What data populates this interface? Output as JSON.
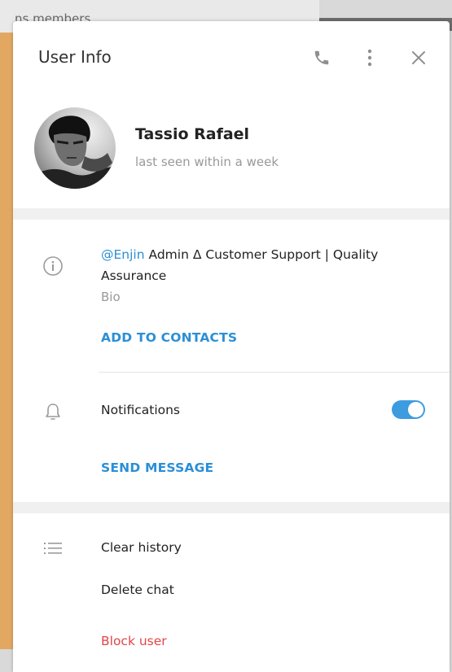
{
  "backdrop": {
    "partial_text": "ns members"
  },
  "header": {
    "title": "User Info",
    "icons": [
      "phone-icon",
      "more-vertical-icon",
      "close-icon"
    ]
  },
  "profile": {
    "name": "Tassio Rafael",
    "status": "last seen within a week"
  },
  "bio": {
    "mention": "@Enjin",
    "text": " Admin Δ Customer Support | Quality Assurance",
    "label": "Bio"
  },
  "actions": {
    "add_to_contacts": "ADD TO CONTACTS",
    "notifications_label": "Notifications",
    "notifications_enabled": true,
    "send_message": "SEND MESSAGE",
    "clear_history": "Clear history",
    "delete_chat": "Delete chat",
    "block_user": "Block user"
  },
  "colors": {
    "accent": "#2b8fd6",
    "danger": "#e0454a",
    "toggle_on": "#3d9be0"
  }
}
